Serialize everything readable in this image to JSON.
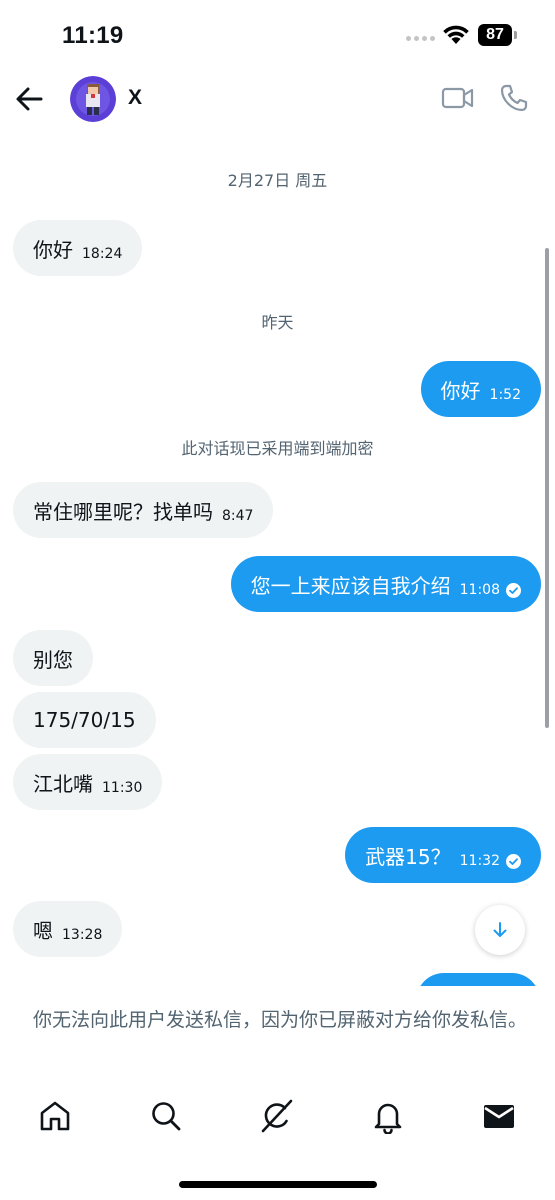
{
  "status_bar": {
    "time": "11:19",
    "battery": "87"
  },
  "header": {
    "contact_name": "X"
  },
  "chat": {
    "separators": [
      "2月27日 周五",
      "昨天",
      "此对话现已采用端到端加密"
    ],
    "messages": [
      {
        "text": "你好",
        "time": "18:24",
        "dir": "in"
      },
      {
        "text": "你好",
        "time": "1:52",
        "dir": "out"
      },
      {
        "text": "常住哪里呢？找单吗",
        "time": "8:47",
        "dir": "in"
      },
      {
        "text": "您一上来应该自我介绍",
        "time": "11:08",
        "dir": "out",
        "read": true
      },
      {
        "text": "别您",
        "time": "",
        "dir": "in"
      },
      {
        "text": "175/70/15",
        "time": "",
        "dir": "in"
      },
      {
        "text": "江北嘴",
        "time": "11:30",
        "dir": "in"
      },
      {
        "text": "武器15？",
        "time": "11:32",
        "dir": "out",
        "read": true
      },
      {
        "text": "嗯",
        "time": "13:28",
        "dir": "in"
      }
    ]
  },
  "notice": "你无法向此用户发送私信，因为你已屏蔽对方给你发私信。",
  "icons": {
    "back": "arrow-left-icon",
    "video": "video-camera-icon",
    "call": "phone-icon",
    "scroll_down": "arrow-down-icon",
    "nav": [
      "home-icon",
      "search-icon",
      "grok-icon",
      "bell-icon",
      "mail-icon"
    ]
  },
  "colors": {
    "accent": "#1d9bf0",
    "incoming_bubble": "#eff3f4",
    "secondary_text": "#536471"
  }
}
